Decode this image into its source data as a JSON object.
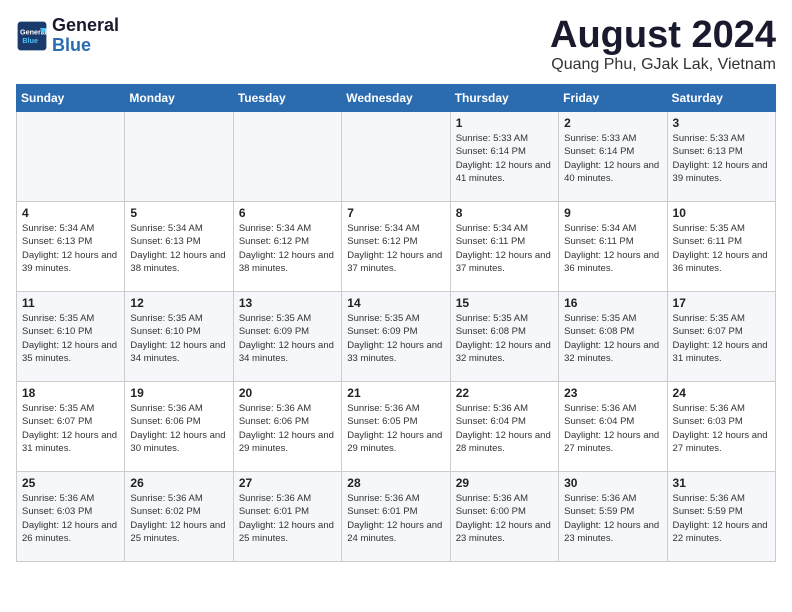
{
  "header": {
    "logo_line1": "General",
    "logo_line2": "Blue",
    "title": "August 2024",
    "subtitle": "Quang Phu, GJak Lak, Vietnam"
  },
  "days_of_week": [
    "Sunday",
    "Monday",
    "Tuesday",
    "Wednesday",
    "Thursday",
    "Friday",
    "Saturday"
  ],
  "weeks": [
    [
      {
        "day": "",
        "sunrise": "",
        "sunset": "",
        "daylight": ""
      },
      {
        "day": "",
        "sunrise": "",
        "sunset": "",
        "daylight": ""
      },
      {
        "day": "",
        "sunrise": "",
        "sunset": "",
        "daylight": ""
      },
      {
        "day": "",
        "sunrise": "",
        "sunset": "",
        "daylight": ""
      },
      {
        "day": "1",
        "sunrise": "Sunrise: 5:33 AM",
        "sunset": "Sunset: 6:14 PM",
        "daylight": "Daylight: 12 hours and 41 minutes."
      },
      {
        "day": "2",
        "sunrise": "Sunrise: 5:33 AM",
        "sunset": "Sunset: 6:14 PM",
        "daylight": "Daylight: 12 hours and 40 minutes."
      },
      {
        "day": "3",
        "sunrise": "Sunrise: 5:33 AM",
        "sunset": "Sunset: 6:13 PM",
        "daylight": "Daylight: 12 hours and 39 minutes."
      }
    ],
    [
      {
        "day": "4",
        "sunrise": "Sunrise: 5:34 AM",
        "sunset": "Sunset: 6:13 PM",
        "daylight": "Daylight: 12 hours and 39 minutes."
      },
      {
        "day": "5",
        "sunrise": "Sunrise: 5:34 AM",
        "sunset": "Sunset: 6:13 PM",
        "daylight": "Daylight: 12 hours and 38 minutes."
      },
      {
        "day": "6",
        "sunrise": "Sunrise: 5:34 AM",
        "sunset": "Sunset: 6:12 PM",
        "daylight": "Daylight: 12 hours and 38 minutes."
      },
      {
        "day": "7",
        "sunrise": "Sunrise: 5:34 AM",
        "sunset": "Sunset: 6:12 PM",
        "daylight": "Daylight: 12 hours and 37 minutes."
      },
      {
        "day": "8",
        "sunrise": "Sunrise: 5:34 AM",
        "sunset": "Sunset: 6:11 PM",
        "daylight": "Daylight: 12 hours and 37 minutes."
      },
      {
        "day": "9",
        "sunrise": "Sunrise: 5:34 AM",
        "sunset": "Sunset: 6:11 PM",
        "daylight": "Daylight: 12 hours and 36 minutes."
      },
      {
        "day": "10",
        "sunrise": "Sunrise: 5:35 AM",
        "sunset": "Sunset: 6:11 PM",
        "daylight": "Daylight: 12 hours and 36 minutes."
      }
    ],
    [
      {
        "day": "11",
        "sunrise": "Sunrise: 5:35 AM",
        "sunset": "Sunset: 6:10 PM",
        "daylight": "Daylight: 12 hours and 35 minutes."
      },
      {
        "day": "12",
        "sunrise": "Sunrise: 5:35 AM",
        "sunset": "Sunset: 6:10 PM",
        "daylight": "Daylight: 12 hours and 34 minutes."
      },
      {
        "day": "13",
        "sunrise": "Sunrise: 5:35 AM",
        "sunset": "Sunset: 6:09 PM",
        "daylight": "Daylight: 12 hours and 34 minutes."
      },
      {
        "day": "14",
        "sunrise": "Sunrise: 5:35 AM",
        "sunset": "Sunset: 6:09 PM",
        "daylight": "Daylight: 12 hours and 33 minutes."
      },
      {
        "day": "15",
        "sunrise": "Sunrise: 5:35 AM",
        "sunset": "Sunset: 6:08 PM",
        "daylight": "Daylight: 12 hours and 32 minutes."
      },
      {
        "day": "16",
        "sunrise": "Sunrise: 5:35 AM",
        "sunset": "Sunset: 6:08 PM",
        "daylight": "Daylight: 12 hours and 32 minutes."
      },
      {
        "day": "17",
        "sunrise": "Sunrise: 5:35 AM",
        "sunset": "Sunset: 6:07 PM",
        "daylight": "Daylight: 12 hours and 31 minutes."
      }
    ],
    [
      {
        "day": "18",
        "sunrise": "Sunrise: 5:35 AM",
        "sunset": "Sunset: 6:07 PM",
        "daylight": "Daylight: 12 hours and 31 minutes."
      },
      {
        "day": "19",
        "sunrise": "Sunrise: 5:36 AM",
        "sunset": "Sunset: 6:06 PM",
        "daylight": "Daylight: 12 hours and 30 minutes."
      },
      {
        "day": "20",
        "sunrise": "Sunrise: 5:36 AM",
        "sunset": "Sunset: 6:06 PM",
        "daylight": "Daylight: 12 hours and 29 minutes."
      },
      {
        "day": "21",
        "sunrise": "Sunrise: 5:36 AM",
        "sunset": "Sunset: 6:05 PM",
        "daylight": "Daylight: 12 hours and 29 minutes."
      },
      {
        "day": "22",
        "sunrise": "Sunrise: 5:36 AM",
        "sunset": "Sunset: 6:04 PM",
        "daylight": "Daylight: 12 hours and 28 minutes."
      },
      {
        "day": "23",
        "sunrise": "Sunrise: 5:36 AM",
        "sunset": "Sunset: 6:04 PM",
        "daylight": "Daylight: 12 hours and 27 minutes."
      },
      {
        "day": "24",
        "sunrise": "Sunrise: 5:36 AM",
        "sunset": "Sunset: 6:03 PM",
        "daylight": "Daylight: 12 hours and 27 minutes."
      }
    ],
    [
      {
        "day": "25",
        "sunrise": "Sunrise: 5:36 AM",
        "sunset": "Sunset: 6:03 PM",
        "daylight": "Daylight: 12 hours and 26 minutes."
      },
      {
        "day": "26",
        "sunrise": "Sunrise: 5:36 AM",
        "sunset": "Sunset: 6:02 PM",
        "daylight": "Daylight: 12 hours and 25 minutes."
      },
      {
        "day": "27",
        "sunrise": "Sunrise: 5:36 AM",
        "sunset": "Sunset: 6:01 PM",
        "daylight": "Daylight: 12 hours and 25 minutes."
      },
      {
        "day": "28",
        "sunrise": "Sunrise: 5:36 AM",
        "sunset": "Sunset: 6:01 PM",
        "daylight": "Daylight: 12 hours and 24 minutes."
      },
      {
        "day": "29",
        "sunrise": "Sunrise: 5:36 AM",
        "sunset": "Sunset: 6:00 PM",
        "daylight": "Daylight: 12 hours and 23 minutes."
      },
      {
        "day": "30",
        "sunrise": "Sunrise: 5:36 AM",
        "sunset": "Sunset: 5:59 PM",
        "daylight": "Daylight: 12 hours and 23 minutes."
      },
      {
        "day": "31",
        "sunrise": "Sunrise: 5:36 AM",
        "sunset": "Sunset: 5:59 PM",
        "daylight": "Daylight: 12 hours and 22 minutes."
      }
    ]
  ]
}
